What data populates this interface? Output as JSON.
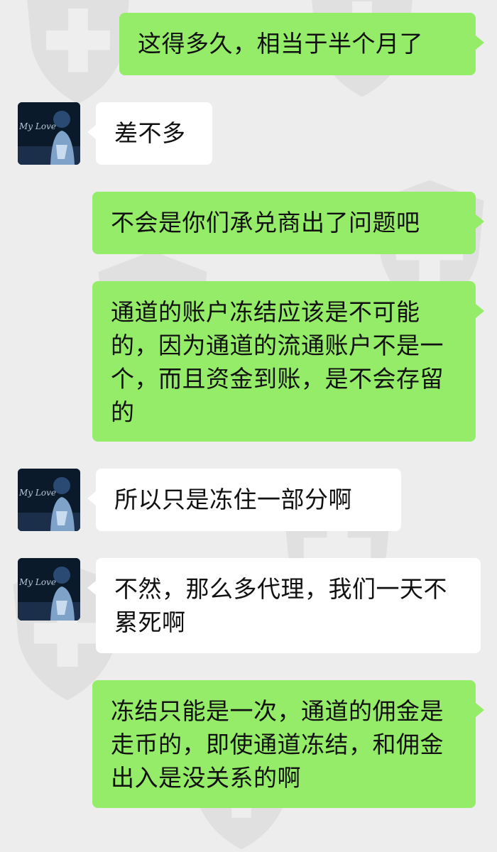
{
  "colors": {
    "background": "#ededed",
    "sent_bubble": "#95ec69",
    "received_bubble": "#ffffff",
    "text": "#111111"
  },
  "avatar": {
    "icon": "user-avatar-icon",
    "caption": "My Love"
  },
  "messages": [
    {
      "side": "sent",
      "text": "这得多久，相当于半个月了"
    },
    {
      "side": "received",
      "text": "差不多"
    },
    {
      "side": "sent",
      "text": "不会是你们承兑商出了问题吧"
    },
    {
      "side": "sent",
      "text": "通道的账户冻结应该是不可能的，因为通道的流通账户不是一个，而且资金到账，是不会存留的"
    },
    {
      "side": "received",
      "text": "所以只是冻住一部分啊"
    },
    {
      "side": "received",
      "text": "不然，那么多代理，我们一天不累死啊"
    },
    {
      "side": "sent",
      "text": "冻结只能是一次，通道的佣金是走币的，即使通道冻结，和佣金出入是没关系的啊"
    }
  ]
}
